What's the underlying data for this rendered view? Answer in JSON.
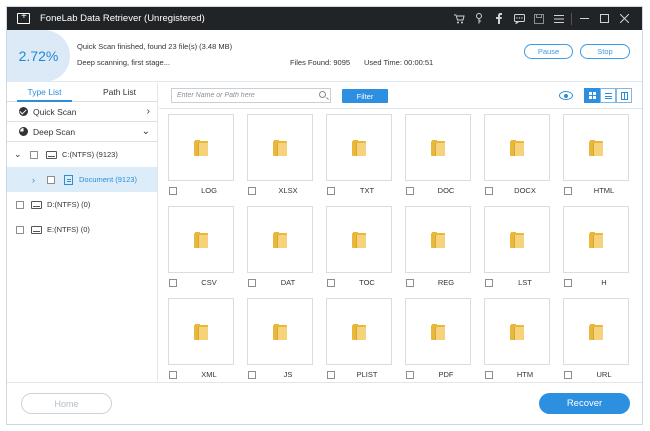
{
  "window": {
    "title": "FoneLab Data Retriever (Unregistered)"
  },
  "titlebar_icons": [
    "cart-icon",
    "key-icon",
    "facebook-icon",
    "chat-icon",
    "save-icon",
    "menu-icon",
    "minimize-icon",
    "maximize-icon",
    "close-icon"
  ],
  "status": {
    "percent": "2.72%",
    "progress_fraction": 0.0272,
    "line1": "Quick Scan finished, found 23 file(s) (3.48 MB)",
    "line2": "Deep scanning, first stage...",
    "files_found": "Files Found: 9095",
    "used_time": "Used Time: 00:00:51",
    "pause_label": "Pause",
    "stop_label": "Stop"
  },
  "sidebar": {
    "tabs": [
      {
        "label": "Type List",
        "active": true
      },
      {
        "label": "Path List",
        "active": false
      }
    ],
    "scans": [
      {
        "label": "Quick Scan",
        "icon": "check-circle-icon",
        "chevron": "chevron-right-icon"
      },
      {
        "label": "Deep Scan",
        "icon": "half-circle-icon",
        "chevron": "chevron-down-icon"
      }
    ],
    "tree": [
      {
        "label": "C:(NTFS) (9123)",
        "expanded": true
      },
      {
        "label": "Document (9123)",
        "selected": true
      },
      {
        "label": "D:(NTFS) (0)"
      },
      {
        "label": "E:(NTFS) (0)"
      }
    ]
  },
  "toolbar": {
    "search_placeholder": "Enter Name or Path here",
    "filter_label": "Filter",
    "view_mode": "grid",
    "accent_color": "#2d8fe0"
  },
  "files": [
    {
      "label": "LOG"
    },
    {
      "label": "XLSX"
    },
    {
      "label": "TXT"
    },
    {
      "label": "DOC"
    },
    {
      "label": "DOCX"
    },
    {
      "label": "HTML"
    },
    {
      "label": "CSV"
    },
    {
      "label": "DAT"
    },
    {
      "label": "TOC"
    },
    {
      "label": "REG"
    },
    {
      "label": "LST"
    },
    {
      "label": "H"
    },
    {
      "label": "XML"
    },
    {
      "label": "JS"
    },
    {
      "label": "PLIST"
    },
    {
      "label": "PDF"
    },
    {
      "label": "HTM"
    },
    {
      "label": "URL"
    }
  ],
  "footer": {
    "home_label": "Home",
    "recover_label": "Recover"
  }
}
